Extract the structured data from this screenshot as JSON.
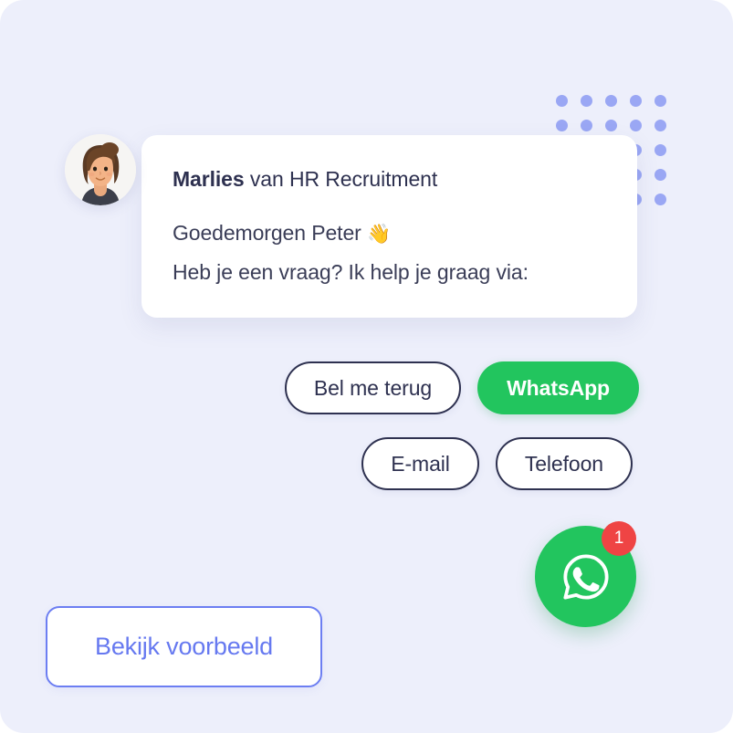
{
  "theme": {
    "background": "#edeffb",
    "card_background": "#ffffff",
    "text_dark": "#2e3150",
    "accent_green": "#22c55e",
    "accent_blue": "#6679f0",
    "badge_red": "#ef4444",
    "dot_color": "#9aa7f4"
  },
  "avatar": {
    "name": "avatar",
    "alt": "Marlies"
  },
  "message_card": {
    "sender_name": "Marlies",
    "sender_role": " van HR Recruitment",
    "greeting": "Goedemorgen Peter ",
    "greeting_emoji": "👋",
    "question": "Heb je een vraag? Ik help je graag via:"
  },
  "channel_buttons": {
    "row1": [
      {
        "label": "Bel me terug",
        "style": "outline"
      },
      {
        "label": "WhatsApp",
        "style": "primary"
      }
    ],
    "row2": [
      {
        "label": "E-mail",
        "style": "outline"
      },
      {
        "label": "Telefoon",
        "style": "outline"
      }
    ]
  },
  "whatsapp_fab": {
    "icon": "whatsapp-icon",
    "badge_count": "1"
  },
  "preview_button": {
    "label": "Bekijk voorbeeld"
  },
  "dot_grid": {
    "columns": 5,
    "rows": 5,
    "spacing": 27,
    "dot_size": 13
  }
}
